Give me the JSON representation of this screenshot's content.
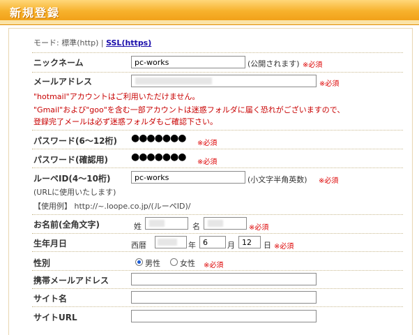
{
  "header": {
    "title": "新規登録"
  },
  "mode": {
    "prefix": "モード: 標準(http) | ",
    "ssl_link": "SSL(https)"
  },
  "required_mark": "※必須",
  "nickname": {
    "label": "ニックネーム",
    "value": "pc-works",
    "note": "(公開されます)"
  },
  "email": {
    "label": "メールアドレス",
    "warning1": "\"hotmail\"アカウントはご利用いただけません。",
    "warning2": "\"Gmail\"および\"goo\"を含む一部アカウントは迷惑フォルダに届く恐れがございますので、",
    "warning3": "登録完了メールは必ず迷惑フォルダもご確認下さい。"
  },
  "password": {
    "label": "パスワード(6～12桁)",
    "masked": "●●●●●●●"
  },
  "password_confirm": {
    "label": "パスワード(確認用)",
    "masked": "●●●●●●●"
  },
  "loope_id": {
    "label": "ルーペID(4～10桁)",
    "value": "pc-works",
    "note": "(小文字半角英数)",
    "hint1": "(URLに使用いたします)",
    "example": "【使用例】 http://~.loope.co.jp/(ルーペID)/"
  },
  "name": {
    "label": "お名前(全角文字)",
    "last_label": "姓",
    "first_label": "名"
  },
  "birthday": {
    "label": "生年月日",
    "era": "西暦",
    "year": "年",
    "month": "月",
    "day": "日",
    "month_value": "6",
    "day_value": "12"
  },
  "gender": {
    "label": "性別",
    "male": "男性",
    "female": "女性"
  },
  "mobile_email": {
    "label": "携帯メールアドレス"
  },
  "site_name": {
    "label": "サイト名"
  },
  "site_url": {
    "label": "サイトURL"
  }
}
